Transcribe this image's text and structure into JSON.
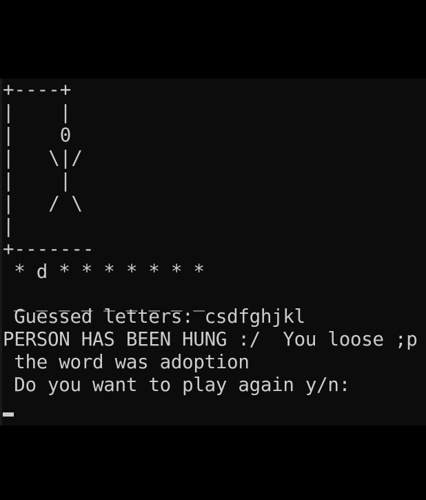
{
  "terminal": {
    "gallows": [
      "+----+",
      "|    |",
      "|    0",
      "|   \\|/",
      "|    |",
      "|   / \\",
      "|",
      "+-------"
    ],
    "word_progress": " * d * * * * * * *",
    "blanks": " _ _ _ _ _ _ _ _ _",
    "guessed_letters": " Guessed letters: csdfghjkl",
    "hung_message": "PERSON HAS BEEN HUNG :/  You loose ;p",
    "reveal_word": " the word was adoption",
    "prompt": " Do you want to play again y/n:"
  },
  "colors": {
    "background": "#0c0c0c",
    "page": "#000000",
    "text": "#cccccc"
  }
}
